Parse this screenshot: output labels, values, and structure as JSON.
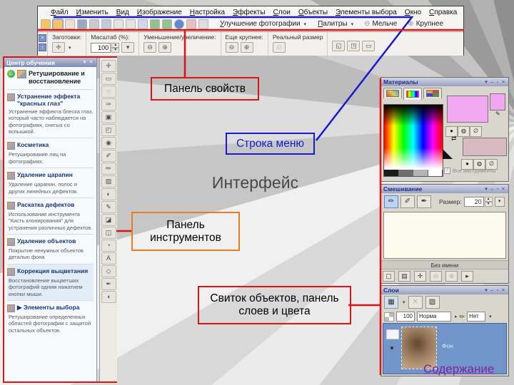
{
  "slide": {
    "interface_title": "Интерфейс",
    "contents_link": "Содержание",
    "labels": {
      "properties": "Панель свойств",
      "menu": "Строка меню",
      "tools": "Панель инструментов",
      "panels": "Свиток объектов, панель слоев и цвета"
    },
    "colors": {
      "red": "#d91515",
      "blue": "#1a1acc",
      "orange": "#e87c1e",
      "link_purple": "#8023a8"
    }
  },
  "menubar": {
    "items": [
      "Файл",
      "Изменить",
      "Вид",
      "Изображение",
      "Настройка",
      "Эффекты",
      "Слои",
      "Объекты",
      "Элементы выбора",
      "Окно",
      "Справка"
    ]
  },
  "standard_toolbar": {
    "icons": [
      {
        "name": "new-file-icon"
      },
      {
        "name": "open-folder-icon"
      },
      {
        "name": "browse-icon"
      },
      {
        "name": "twain-icon"
      },
      {
        "name": "save-icon"
      },
      {
        "name": "print-icon"
      },
      {
        "name": "share-icon"
      },
      {
        "name": "undo-icon"
      },
      {
        "name": "redo-icon"
      },
      {
        "name": "resize-icon"
      },
      {
        "name": "enhance-icon"
      },
      {
        "name": "rotate-icon"
      },
      {
        "name": "info-icon"
      },
      {
        "name": "delete-icon"
      }
    ],
    "enhance_button": "Улучшение фотографии",
    "palettes_button": "Палитры",
    "zoom_out_button": "Мельче",
    "zoom_in_button": "Крупнее",
    "dropdown_char": "▾",
    "zoom_out_glyph": "⊖",
    "zoom_in_glyph": "⊕"
  },
  "tool_options": {
    "presets_label": "Заготовки:",
    "zoom_label": "Масштаб (%):",
    "zoom_value": "100",
    "zoom_buttons_label": "Уменьшение/увеличение:",
    "more_zoom_label": "Еще крупнее:",
    "actual_size_label": "Реальный размер"
  },
  "learning_center": {
    "title": "Центр обучения",
    "header_title": "Ретуширование и восстановление",
    "items": [
      {
        "icon": "red-eye-item-icon",
        "title": "Устранение эффекта \"красных глаз\"",
        "desc": "Устранение эффекта блеска глаз, который часто наблюдается на фотографиях, снятых со вспышкой."
      },
      {
        "icon": "makeover-item-icon",
        "title": "Косметика",
        "desc": "Ретуширование лиц на фотографиях."
      },
      {
        "icon": "scratch-item-icon",
        "title": "Удаление царапин",
        "desc": "Удаление царапин, полос и других линейных дефектов."
      },
      {
        "icon": "clone-item-icon",
        "title": "Раскатка дефектов",
        "desc": "Использование инструмента \"Кисть клонирования\" для устранения различных дефектов."
      },
      {
        "icon": "object-remover-item-icon",
        "title": "Удаление объектов",
        "desc": "Покрытие ненужных объектов деталью фона"
      },
      {
        "icon": "fade-correction-item-icon",
        "title": "Коррекция выцветания",
        "desc": "Восстановление выцветших фотографий одним нажатием кнопки мыши."
      },
      {
        "icon": "selection-item-icon",
        "title": "▶ Элементы выбора",
        "desc": "Ретуширование определенных областей фотографии с защитой остальных объектов."
      }
    ]
  },
  "tools_palette": {
    "tools": [
      {
        "name": "pan-tool-icon",
        "glyph": "✛"
      },
      {
        "name": "selection-tool-icon",
        "glyph": "▭"
      },
      {
        "name": "freehand-selection-tool-icon",
        "glyph": "◌"
      },
      {
        "name": "dropper-tool-icon",
        "glyph": "✑"
      },
      {
        "name": "crop-tool-icon",
        "glyph": "▣"
      },
      {
        "name": "deform-tool-icon",
        "glyph": "◰"
      },
      {
        "name": "red-eye-tool-icon",
        "glyph": "◉"
      },
      {
        "name": "makeover-tool-icon",
        "glyph": "✐"
      },
      {
        "name": "brush-tool-icon",
        "glyph": "✏"
      },
      {
        "name": "clone-brush-tool-icon",
        "glyph": "▨"
      },
      {
        "name": "dodge-burn-tool-icon",
        "glyph": "◐"
      },
      {
        "name": "scratch-remover-tool-icon",
        "glyph": "✎"
      },
      {
        "name": "object-remover-tool-icon",
        "glyph": "◪"
      },
      {
        "name": "eraser-tool-icon",
        "glyph": "◫"
      },
      {
        "name": "picture-tube-tool-icon",
        "glyph": "◔"
      },
      {
        "name": "text-tool-icon",
        "glyph": "A"
      },
      {
        "name": "preset-shape-tool-icon",
        "glyph": "◇"
      },
      {
        "name": "pen-tool-icon",
        "glyph": "✒"
      },
      {
        "name": "warp-brush-tool-icon",
        "glyph": "◖"
      }
    ]
  },
  "materials_panel": {
    "title": "Материалы",
    "all_tools_label": "Все инструменты",
    "fg_color": "#f2a9f2",
    "bg_color": "#d9bac3"
  },
  "mixer_panel": {
    "title": "Смешивание",
    "size_label": "Размер:",
    "size_value": "20",
    "untitled_label": "Без имени"
  },
  "layers_panel": {
    "title": "Слои",
    "opacity_value": "100",
    "blend_mode": "Норма",
    "link_value": "Нет",
    "layer_name": "Фон"
  },
  "chrome": {
    "pin": "▾",
    "min": "–",
    "max": "▫",
    "close": "×",
    "back_arrow": "←"
  }
}
